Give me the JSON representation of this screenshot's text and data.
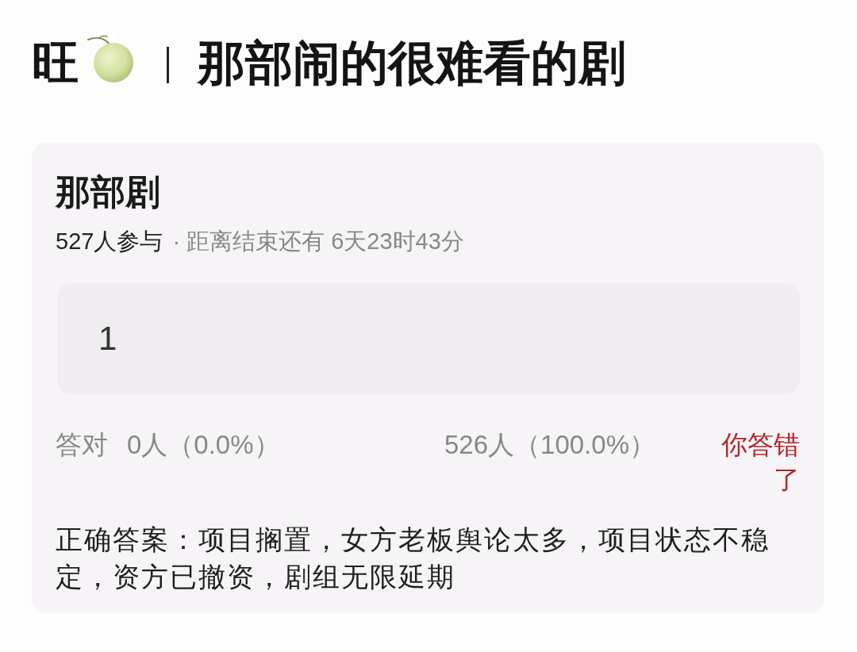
{
  "header": {
    "prefix": "旺",
    "title": "那部闹的很难看的剧"
  },
  "poll": {
    "title": "那部剧",
    "participants": "527人参与",
    "deadline": "· 距离结束还有 6天23时43分",
    "answer": {
      "value": "1"
    },
    "stats": {
      "correct_label": "答对",
      "correct_value": "0人（0.0%）",
      "wrong_value": "526人（100.0%）"
    },
    "result": {
      "text": "你答错了",
      "correct": false
    },
    "correct_answer": "正确答案：项目搁置，女方老板舆论太多，项目状态不稳定，资方已撤资，剧组无限延期"
  }
}
